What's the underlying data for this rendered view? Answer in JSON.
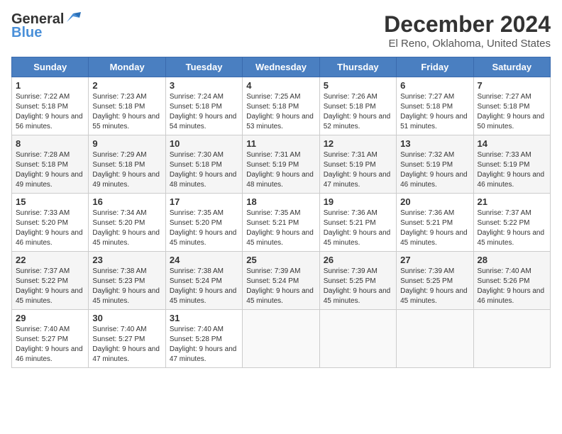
{
  "header": {
    "logo_general": "General",
    "logo_blue": "Blue",
    "month_title": "December 2024",
    "location": "El Reno, Oklahoma, United States"
  },
  "calendar": {
    "days_of_week": [
      "Sunday",
      "Monday",
      "Tuesday",
      "Wednesday",
      "Thursday",
      "Friday",
      "Saturday"
    ],
    "weeks": [
      [
        {
          "day": "",
          "info": ""
        },
        {
          "day": "",
          "info": ""
        },
        {
          "day": "",
          "info": ""
        },
        {
          "day": "",
          "info": ""
        },
        {
          "day": "",
          "info": ""
        },
        {
          "day": "",
          "info": ""
        },
        {
          "day": "",
          "info": ""
        }
      ]
    ]
  },
  "cells": {
    "empty": "",
    "week1": [
      {
        "num": "1",
        "sunrise": "7:22 AM",
        "sunset": "5:18 PM",
        "daylight": "9 hours and 56 minutes."
      },
      {
        "num": "2",
        "sunrise": "7:23 AM",
        "sunset": "5:18 PM",
        "daylight": "9 hours and 55 minutes."
      },
      {
        "num": "3",
        "sunrise": "7:24 AM",
        "sunset": "5:18 PM",
        "daylight": "9 hours and 54 minutes."
      },
      {
        "num": "4",
        "sunrise": "7:25 AM",
        "sunset": "5:18 PM",
        "daylight": "9 hours and 53 minutes."
      },
      {
        "num": "5",
        "sunrise": "7:26 AM",
        "sunset": "5:18 PM",
        "daylight": "9 hours and 52 minutes."
      },
      {
        "num": "6",
        "sunrise": "7:27 AM",
        "sunset": "5:18 PM",
        "daylight": "9 hours and 51 minutes."
      },
      {
        "num": "7",
        "sunrise": "7:27 AM",
        "sunset": "5:18 PM",
        "daylight": "9 hours and 50 minutes."
      }
    ],
    "week2": [
      {
        "num": "8",
        "sunrise": "7:28 AM",
        "sunset": "5:18 PM",
        "daylight": "9 hours and 49 minutes."
      },
      {
        "num": "9",
        "sunrise": "7:29 AM",
        "sunset": "5:18 PM",
        "daylight": "9 hours and 49 minutes."
      },
      {
        "num": "10",
        "sunrise": "7:30 AM",
        "sunset": "5:18 PM",
        "daylight": "9 hours and 48 minutes."
      },
      {
        "num": "11",
        "sunrise": "7:31 AM",
        "sunset": "5:19 PM",
        "daylight": "9 hours and 48 minutes."
      },
      {
        "num": "12",
        "sunrise": "7:31 AM",
        "sunset": "5:19 PM",
        "daylight": "9 hours and 47 minutes."
      },
      {
        "num": "13",
        "sunrise": "7:32 AM",
        "sunset": "5:19 PM",
        "daylight": "9 hours and 46 minutes."
      },
      {
        "num": "14",
        "sunrise": "7:33 AM",
        "sunset": "5:19 PM",
        "daylight": "9 hours and 46 minutes."
      }
    ],
    "week3": [
      {
        "num": "15",
        "sunrise": "7:33 AM",
        "sunset": "5:20 PM",
        "daylight": "9 hours and 46 minutes."
      },
      {
        "num": "16",
        "sunrise": "7:34 AM",
        "sunset": "5:20 PM",
        "daylight": "9 hours and 45 minutes."
      },
      {
        "num": "17",
        "sunrise": "7:35 AM",
        "sunset": "5:20 PM",
        "daylight": "9 hours and 45 minutes."
      },
      {
        "num": "18",
        "sunrise": "7:35 AM",
        "sunset": "5:21 PM",
        "daylight": "9 hours and 45 minutes."
      },
      {
        "num": "19",
        "sunrise": "7:36 AM",
        "sunset": "5:21 PM",
        "daylight": "9 hours and 45 minutes."
      },
      {
        "num": "20",
        "sunrise": "7:36 AM",
        "sunset": "5:21 PM",
        "daylight": "9 hours and 45 minutes."
      },
      {
        "num": "21",
        "sunrise": "7:37 AM",
        "sunset": "5:22 PM",
        "daylight": "9 hours and 45 minutes."
      }
    ],
    "week4": [
      {
        "num": "22",
        "sunrise": "7:37 AM",
        "sunset": "5:22 PM",
        "daylight": "9 hours and 45 minutes."
      },
      {
        "num": "23",
        "sunrise": "7:38 AM",
        "sunset": "5:23 PM",
        "daylight": "9 hours and 45 minutes."
      },
      {
        "num": "24",
        "sunrise": "7:38 AM",
        "sunset": "5:24 PM",
        "daylight": "9 hours and 45 minutes."
      },
      {
        "num": "25",
        "sunrise": "7:39 AM",
        "sunset": "5:24 PM",
        "daylight": "9 hours and 45 minutes."
      },
      {
        "num": "26",
        "sunrise": "7:39 AM",
        "sunset": "5:25 PM",
        "daylight": "9 hours and 45 minutes."
      },
      {
        "num": "27",
        "sunrise": "7:39 AM",
        "sunset": "5:25 PM",
        "daylight": "9 hours and 45 minutes."
      },
      {
        "num": "28",
        "sunrise": "7:40 AM",
        "sunset": "5:26 PM",
        "daylight": "9 hours and 46 minutes."
      }
    ],
    "week5": [
      {
        "num": "29",
        "sunrise": "7:40 AM",
        "sunset": "5:27 PM",
        "daylight": "9 hours and 46 minutes."
      },
      {
        "num": "30",
        "sunrise": "7:40 AM",
        "sunset": "5:27 PM",
        "daylight": "9 hours and 47 minutes."
      },
      {
        "num": "31",
        "sunrise": "7:40 AM",
        "sunset": "5:28 PM",
        "daylight": "9 hours and 47 minutes."
      },
      null,
      null,
      null,
      null
    ]
  },
  "labels": {
    "sunrise": "Sunrise:",
    "sunset": "Sunset:",
    "daylight": "Daylight:"
  }
}
